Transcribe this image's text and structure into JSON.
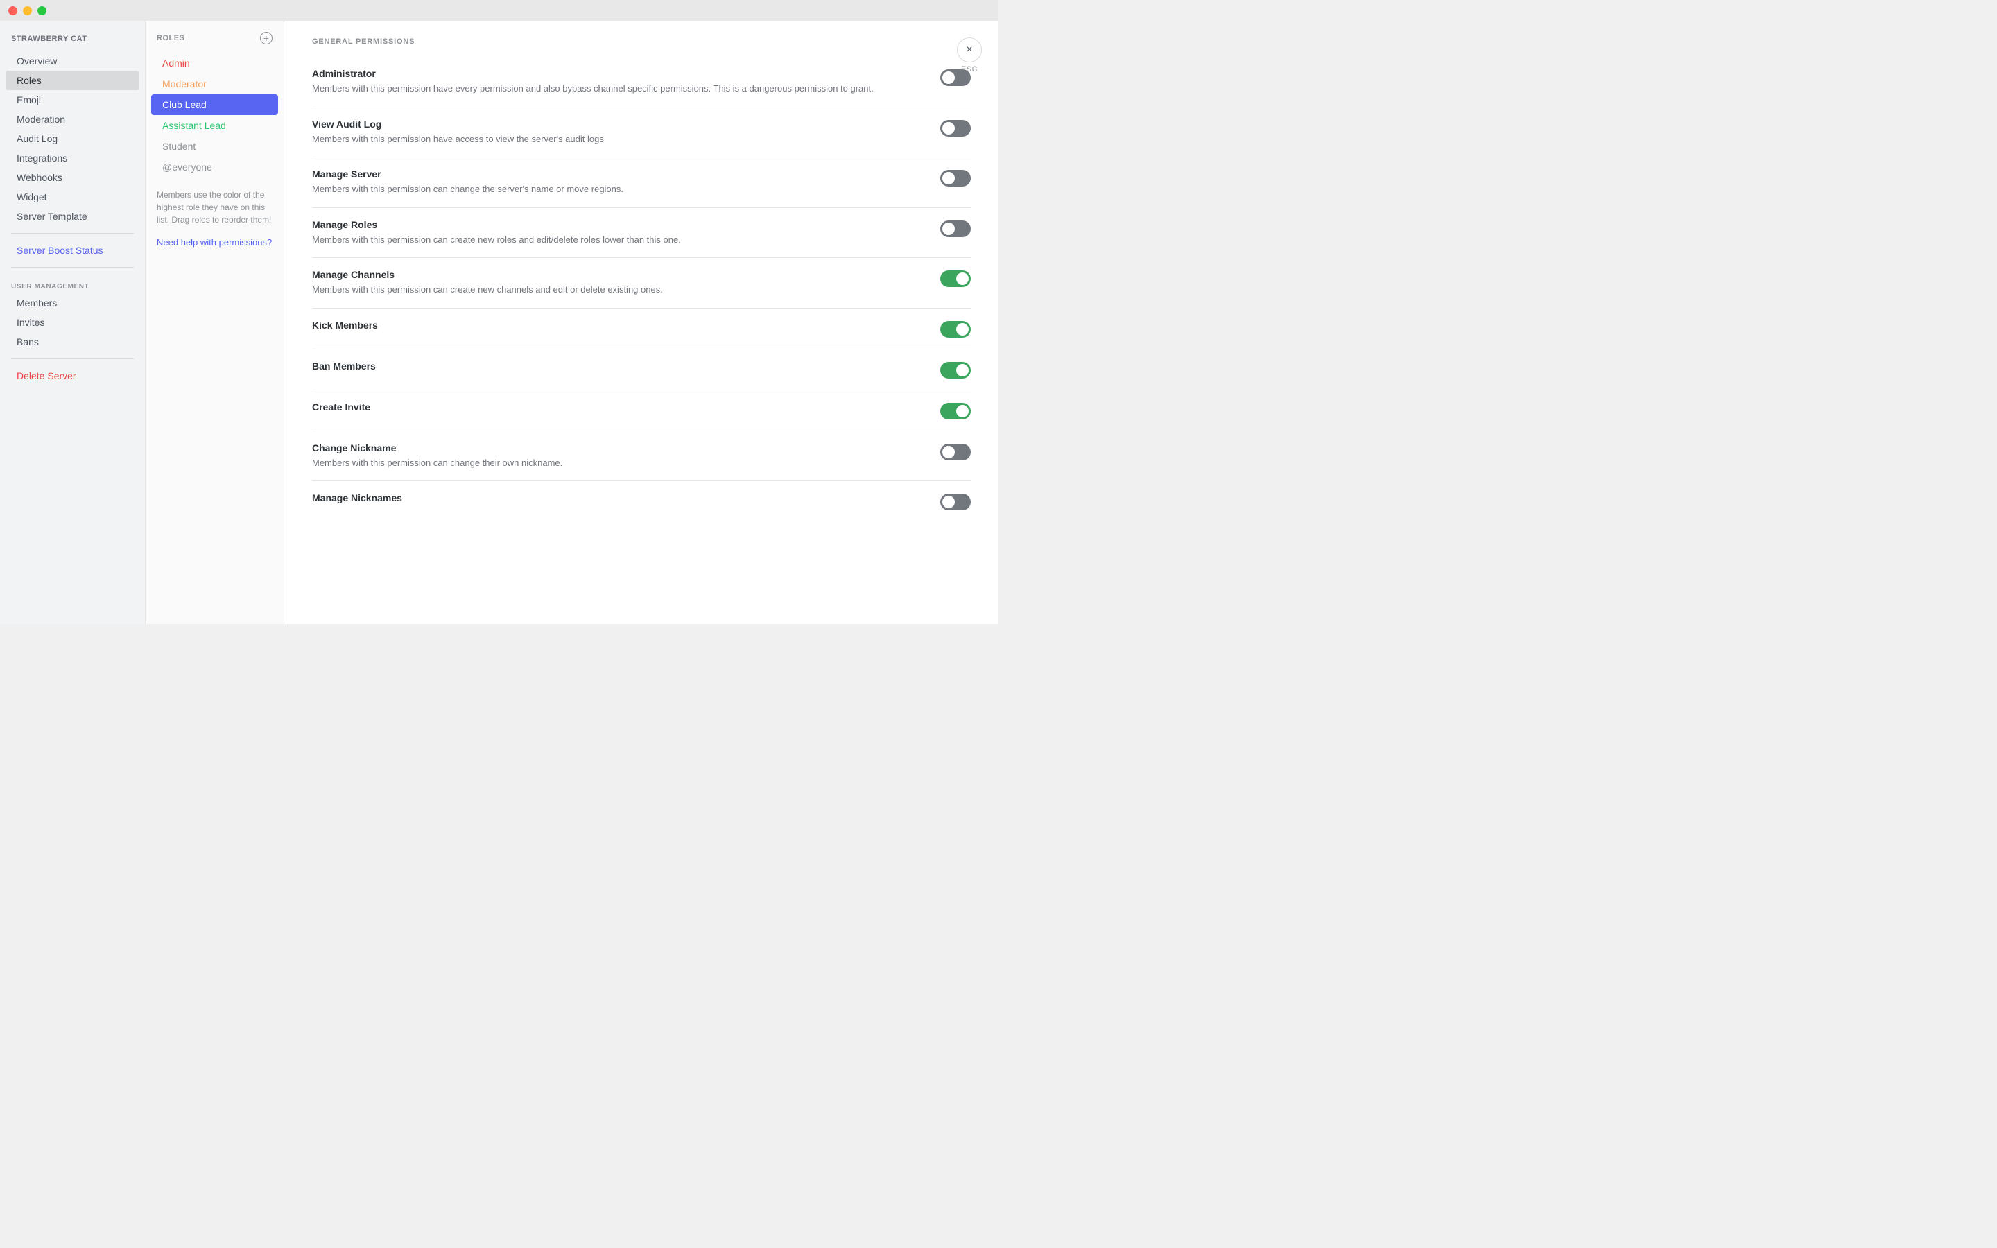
{
  "titlebar": {
    "close_label": "",
    "minimize_label": "",
    "maximize_label": ""
  },
  "sidebar": {
    "server_name": "STRAWBERRY CAT",
    "items": [
      {
        "id": "overview",
        "label": "Overview",
        "active": false,
        "class": ""
      },
      {
        "id": "roles",
        "label": "Roles",
        "active": true,
        "class": ""
      },
      {
        "id": "emoji",
        "label": "Emoji",
        "active": false,
        "class": ""
      },
      {
        "id": "moderation",
        "label": "Moderation",
        "active": false,
        "class": ""
      },
      {
        "id": "audit-log",
        "label": "Audit Log",
        "active": false,
        "class": ""
      },
      {
        "id": "integrations",
        "label": "Integrations",
        "active": false,
        "class": ""
      },
      {
        "id": "webhooks",
        "label": "Webhooks",
        "active": false,
        "class": ""
      },
      {
        "id": "widget",
        "label": "Widget",
        "active": false,
        "class": ""
      },
      {
        "id": "server-template",
        "label": "Server Template",
        "active": false,
        "class": ""
      }
    ],
    "boost_status_label": "Server Boost Status",
    "user_management_header": "USER MANAGEMENT",
    "user_management_items": [
      {
        "id": "members",
        "label": "Members"
      },
      {
        "id": "invites",
        "label": "Invites"
      },
      {
        "id": "bans",
        "label": "Bans"
      }
    ],
    "danger_items": [
      {
        "id": "delete-server",
        "label": "Delete Server"
      }
    ]
  },
  "roles_panel": {
    "header_label": "ROLES",
    "add_button_label": "+",
    "roles": [
      {
        "id": "admin",
        "label": "Admin",
        "color_class": "color-red",
        "selected": false
      },
      {
        "id": "moderator",
        "label": "Moderator",
        "color_class": "color-orange",
        "selected": false
      },
      {
        "id": "club-lead",
        "label": "Club Lead",
        "color_class": "",
        "selected": true
      },
      {
        "id": "assistant-lead",
        "label": "Assistant Lead",
        "color_class": "color-teal",
        "selected": false
      },
      {
        "id": "student",
        "label": "Student",
        "color_class": "color-gray",
        "selected": false
      },
      {
        "id": "everyone",
        "label": "@everyone",
        "color_class": "color-gray",
        "selected": false
      }
    ],
    "hint_text": "Members use the color of the highest role they have on this list. Drag roles to reorder them!",
    "help_link": "Need help with permissions?"
  },
  "permissions": {
    "section_label": "GENERAL PERMISSIONS",
    "esc_label": "ESC",
    "esc_icon": "×",
    "items": [
      {
        "id": "administrator",
        "name": "Administrator",
        "desc": "Members with this permission have every permission and also bypass channel specific permissions. This is a dangerous permission to grant.",
        "enabled": false
      },
      {
        "id": "view-audit-log",
        "name": "View Audit Log",
        "desc": "Members with this permission have access to view the server's audit logs",
        "enabled": false
      },
      {
        "id": "manage-server",
        "name": "Manage Server",
        "desc": "Members with this permission can change the server's name or move regions.",
        "enabled": false
      },
      {
        "id": "manage-roles",
        "name": "Manage Roles",
        "desc": "Members with this permission can create new roles and edit/delete roles lower than this one.",
        "enabled": false
      },
      {
        "id": "manage-channels",
        "name": "Manage Channels",
        "desc": "Members with this permission can create new channels and edit or delete existing ones.",
        "enabled": true
      },
      {
        "id": "kick-members",
        "name": "Kick Members",
        "desc": "",
        "enabled": true
      },
      {
        "id": "ban-members",
        "name": "Ban Members",
        "desc": "",
        "enabled": true
      },
      {
        "id": "create-invite",
        "name": "Create Invite",
        "desc": "",
        "enabled": true
      },
      {
        "id": "change-nickname",
        "name": "Change Nickname",
        "desc": "Members with this permission can change their own nickname.",
        "enabled": false
      },
      {
        "id": "manage-nicknames",
        "name": "Manage Nicknames",
        "desc": "",
        "enabled": false
      }
    ]
  }
}
